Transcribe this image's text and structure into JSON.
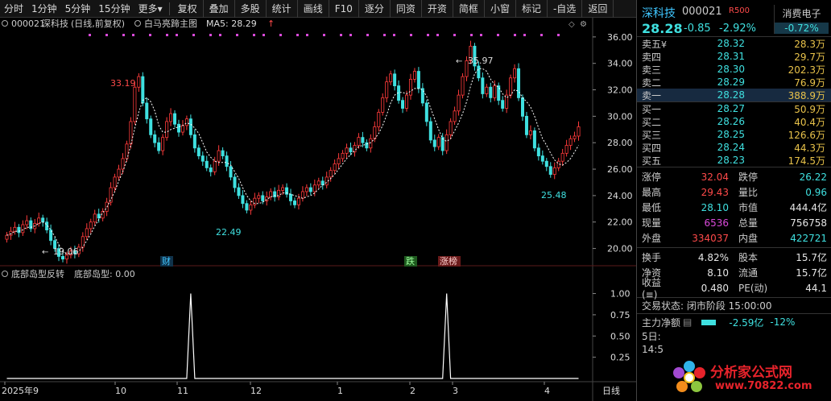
{
  "toolbar": {
    "items": [
      "分时",
      "1分钟",
      "5分钟",
      "15分钟",
      "更多"
    ],
    "more_arrow": "▾",
    "buttons": [
      "复权",
      "叠加",
      "多股",
      "统计",
      "画线",
      "F10",
      "逐分",
      "同资",
      "开资",
      "简框",
      "小窗",
      "标记",
      "-自选",
      "返回"
    ]
  },
  "chart_header": {
    "code": "000021",
    "name": "深科技",
    "mode": "(日线,前复权)",
    "indicator": "白马亮蹄主图",
    "ma_label": "MA5: 28.29",
    "ma_arrow": "↑"
  },
  "sub_header": {
    "name": "底部岛型反转",
    "value_label": "底部岛型: 0.00"
  },
  "annotations": {
    "high1": "33.19",
    "low1": "22.49",
    "start_low": "19.06",
    "peak": "35.97",
    "end_low": "25.48",
    "tag_cai": "财",
    "tag_die": "跌",
    "tag_zhangbang": "涨榜"
  },
  "x_axis_labels": [
    "2025年9",
    "10",
    "11",
    "12",
    "1",
    "2",
    "3",
    "4"
  ],
  "x_axis_right": "日线",
  "chart_data": {
    "type": "candlestick",
    "y_ticks": [
      20.0,
      22.0,
      24.0,
      26.0,
      28.0,
      30.0,
      32.0,
      34.0,
      36.0
    ],
    "ylim": [
      19.0,
      36.6
    ],
    "sub_y_ticks": [
      0.25,
      0.5,
      0.75,
      1.0
    ],
    "sub_ylim": [
      0,
      1.1
    ],
    "up_color": "#ff3b3b",
    "down_color": "#3fe0e0",
    "ma_color": "#ffffff",
    "closes": [
      21.0,
      21.3,
      21.6,
      21.2,
      21.8,
      22.1,
      21.5,
      21.9,
      22.3,
      22.0,
      21.4,
      20.6,
      20.0,
      19.4,
      19.2,
      19.5,
      19.8,
      19.6,
      20.1,
      20.9,
      21.5,
      22.0,
      22.6,
      22.3,
      22.8,
      23.5,
      24.6,
      25.4,
      26.0,
      26.8,
      27.9,
      29.6,
      32.2,
      33.0,
      31.0,
      29.8,
      28.6,
      28.0,
      27.4,
      28.4,
      29.6,
      30.2,
      29.4,
      28.8,
      29.3,
      29.8,
      28.6,
      27.6,
      27.0,
      26.6,
      26.1,
      25.8,
      26.6,
      27.4,
      27.0,
      26.2,
      25.4,
      24.6,
      24.0,
      23.4,
      22.9,
      23.3,
      23.8,
      24.0,
      23.6,
      23.9,
      24.3,
      23.9,
      24.4,
      24.6,
      24.1,
      23.6,
      23.3,
      23.8,
      24.3,
      24.6,
      24.3,
      24.8,
      25.1,
      24.8,
      25.4,
      25.9,
      26.4,
      26.8,
      27.2,
      27.6,
      27.3,
      27.8,
      28.4,
      28.0,
      27.6,
      28.3,
      29.2,
      30.3,
      31.4,
      32.6,
      33.2,
      32.3,
      31.2,
      30.6,
      31.6,
      32.8,
      33.4,
      32.1,
      31.0,
      29.6,
      28.2,
      27.7,
      28.4,
      27.4,
      28.6,
      29.6,
      30.4,
      31.6,
      33.0,
      34.2,
      35.3,
      33.8,
      32.9,
      31.7,
      32.2,
      31.4,
      32.3,
      31.2,
      30.6,
      31.6,
      32.9,
      33.6,
      31.4,
      30.0,
      28.6,
      28.9,
      27.6,
      27.0,
      26.6,
      26.2,
      25.6,
      26.1,
      26.6,
      27.2,
      27.8,
      28.3,
      28.5,
      29.2
    ],
    "ma5": [
      21.0,
      21.1,
      21.3,
      21.3,
      21.4,
      21.6,
      21.6,
      21.7,
      21.9,
      22.0,
      21.8,
      21.4,
      20.9,
      20.3,
      19.8,
      19.6,
      19.6,
      19.6,
      19.8,
      20.1,
      20.6,
      21.1,
      21.7,
      22.2,
      22.7,
      23.1,
      23.7,
      24.3,
      25.1,
      25.8,
      26.7,
      27.8,
      29.1,
      30.3,
      31.2,
      31.4,
      31.1,
      30.4,
      29.3,
      28.8,
      28.8,
      29.0,
      29.1,
      29.2,
      29.3,
      29.5,
      29.4,
      29.1,
      28.7,
      28.0,
      27.3,
      26.9,
      26.6,
      26.5,
      26.5,
      26.5,
      26.3,
      25.8,
      25.3,
      24.6,
      24.0,
      23.6,
      23.4,
      23.4,
      23.5,
      23.7,
      23.9,
      24.0,
      24.0,
      24.2,
      24.2,
      24.1,
      24.0,
      23.9,
      23.8,
      23.9,
      24.0,
      24.2,
      24.5,
      24.8,
      25.0,
      25.3,
      25.6,
      26.0,
      26.4,
      26.8,
      27.1,
      27.4,
      27.7,
      27.8,
      27.9,
      28.0,
      28.3,
      28.7,
      29.3,
      30.1,
      31.0,
      31.6,
      31.8,
      31.8,
      31.7,
      31.9,
      32.1,
      32.1,
      32.0,
      31.5,
      30.6,
      29.8,
      29.0,
      28.3,
      28.1,
      28.3,
      28.9,
      29.5,
      30.2,
      31.1,
      32.3,
      33.2,
      33.6,
      33.6,
      33.4,
      32.8,
      32.4,
      32.2,
      31.7,
      31.4,
      31.6,
      32.0,
      31.9,
      31.4,
      31.1,
      30.7,
      30.0,
      29.1,
      28.3,
      27.8,
      27.2,
      26.7,
      26.4,
      26.3,
      26.5,
      26.8,
      27.3,
      27.8
    ],
    "spike_index": [
      46,
      110
    ]
  },
  "panel": {
    "name": "深科技",
    "code": "000021",
    "r_badge": "R500",
    "price": "28.28",
    "change": "-0.85",
    "change_pct": "-2.92%",
    "sector_name": "消费电子",
    "sector_chg": "-0.72%",
    "asks": [
      {
        "label": "卖五",
        "mark": "¥",
        "price": "28.32",
        "vol": "28.3万"
      },
      {
        "label": "卖四",
        "mark": "",
        "price": "28.31",
        "vol": "29.7万"
      },
      {
        "label": "卖三",
        "mark": "",
        "price": "28.30",
        "vol": "202.3万"
      },
      {
        "label": "卖二",
        "mark": "",
        "price": "28.29",
        "vol": "76.9万"
      },
      {
        "label": "卖一",
        "mark": "",
        "price": "28.28",
        "vol": "388.9万"
      }
    ],
    "bids": [
      {
        "label": "买一",
        "price": "28.27",
        "vol": "50.9万"
      },
      {
        "label": "买二",
        "price": "28.26",
        "vol": "40.4万"
      },
      {
        "label": "买三",
        "price": "28.25",
        "vol": "126.6万"
      },
      {
        "label": "买四",
        "price": "28.24",
        "vol": "44.3万"
      },
      {
        "label": "买五",
        "price": "28.23",
        "vol": "174.5万"
      }
    ],
    "stats": [
      {
        "k": "涨停",
        "v": "32.04",
        "vc": "c-red",
        "k2": "跌停",
        "v2": "26.22",
        "v2c": "c-cyan"
      },
      {
        "k": "最高",
        "v": "29.43",
        "vc": "c-red",
        "k2": "量比",
        "v2": "0.96",
        "v2c": "c-cyan"
      },
      {
        "k": "最低",
        "v": "28.10",
        "vc": "c-cyan",
        "k2": "市值",
        "v2": "444.4亿",
        "v2c": "c-white"
      },
      {
        "k": "现量",
        "v": "6536",
        "vc": "c-mag",
        "k2": "总量",
        "v2": "756758",
        "v2c": "c-white"
      },
      {
        "k": "外盘",
        "v": "334037",
        "vc": "c-red",
        "k2": "内盘",
        "v2": "422721",
        "v2c": "c-cyan"
      }
    ],
    "stats2": [
      {
        "k": "换手",
        "v": "4.82%",
        "vc": "c-white",
        "k2": "股本",
        "v2": "15.7亿",
        "v2c": "c-white"
      },
      {
        "k": "净资",
        "v": "8.10",
        "vc": "c-white",
        "k2": "流通",
        "v2": "15.7亿",
        "v2c": "c-white"
      },
      {
        "k": "收益(≡)",
        "v": "0.480",
        "vc": "c-white",
        "k2": "PE(动)",
        "v2": "44.1",
        "v2c": "c-white"
      }
    ],
    "trade_status": "交易状态: 闭市阶段 15:00:00",
    "main_flow_label": "主力净额",
    "main_flow_val": "-2.59亿",
    "main_flow_pct": "-12%",
    "day5": "5日:",
    "clock": "14:5"
  },
  "watermark": {
    "line1": "分析家公式网",
    "line2": "www.70822.com"
  }
}
